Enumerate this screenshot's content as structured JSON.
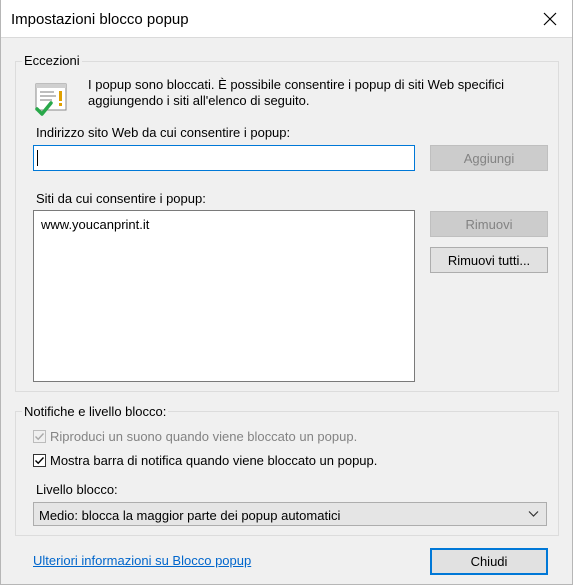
{
  "window": {
    "title": "Impostazioni blocco popup"
  },
  "exceptions": {
    "legend": "Eccezioni",
    "info_line1": "I popup sono bloccati. È possibile consentire i popup di siti Web specifici",
    "info_line2": "aggiungendo i siti all'elenco di seguito.",
    "address_label": "Indirizzo sito Web da cui consentire i popup:",
    "address_value": "",
    "add_button": "Aggiungi",
    "allowed_label": "Siti da cui consentire i popup:",
    "allowed_sites": [
      "www.youcanprint.it"
    ],
    "remove_button": "Rimuovi",
    "remove_all_button": "Rimuovi tutti..."
  },
  "notifications": {
    "legend": "Notifiche e livello blocco:",
    "play_sound_label": "Riproduci un suono quando viene bloccato un popup.",
    "play_sound_checked": true,
    "show_bar_label": "Mostra barra di notifica quando viene bloccato un popup.",
    "show_bar_checked": true,
    "level_label": "Livello blocco:",
    "level_value": "Medio: blocca la maggior parte dei popup automatici"
  },
  "footer": {
    "more_info_link": "Ulteriori informazioni su Blocco popup",
    "close_button": "Chiudi"
  },
  "icons": {
    "window_close": "close-icon",
    "info": "popup-info-icon",
    "dropdown": "chevron-down-icon"
  },
  "colors": {
    "accent": "#0078d7",
    "link": "#0066cc"
  }
}
